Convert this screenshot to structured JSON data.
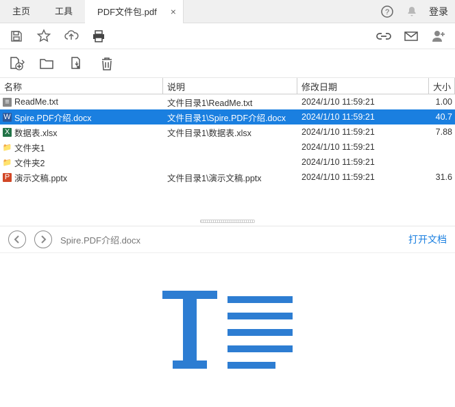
{
  "tabs": {
    "home": "主页",
    "tools": "工具",
    "doc": "PDF文件包.pdf",
    "login": "登录"
  },
  "columns": {
    "name": "名称",
    "desc": "说明",
    "date": "修改日期",
    "size": "大小"
  },
  "rows": [
    {
      "icon": "txt",
      "name": "ReadMe.txt",
      "desc": "文件目录1\\ReadMe.txt",
      "date": "2024/1/10 11:59:21",
      "size": "1.00",
      "selected": false
    },
    {
      "icon": "docx",
      "name": "Spire.PDF介绍.docx",
      "desc": "文件目录1\\Spire.PDF介绍.docx",
      "date": "2024/1/10 11:59:21",
      "size": "40.7",
      "selected": true
    },
    {
      "icon": "xlsx",
      "name": "数据表.xlsx",
      "desc": "文件目录1\\数据表.xlsx",
      "date": "2024/1/10 11:59:21",
      "size": "7.88",
      "selected": false
    },
    {
      "icon": "folder",
      "name": "文件夹1",
      "desc": "",
      "date": "2024/1/10 11:59:21",
      "size": "",
      "selected": false
    },
    {
      "icon": "folder",
      "name": "文件夹2",
      "desc": "",
      "date": "2024/1/10 11:59:21",
      "size": "",
      "selected": false
    },
    {
      "icon": "pptx",
      "name": "演示文稿.pptx",
      "desc": "文件目录1\\演示文稿.pptx",
      "date": "2024/1/10 11:59:21",
      "size": "31.6",
      "selected": false
    }
  ],
  "preview": {
    "title": "Spire.PDF介绍.docx",
    "open": "打开文档"
  }
}
